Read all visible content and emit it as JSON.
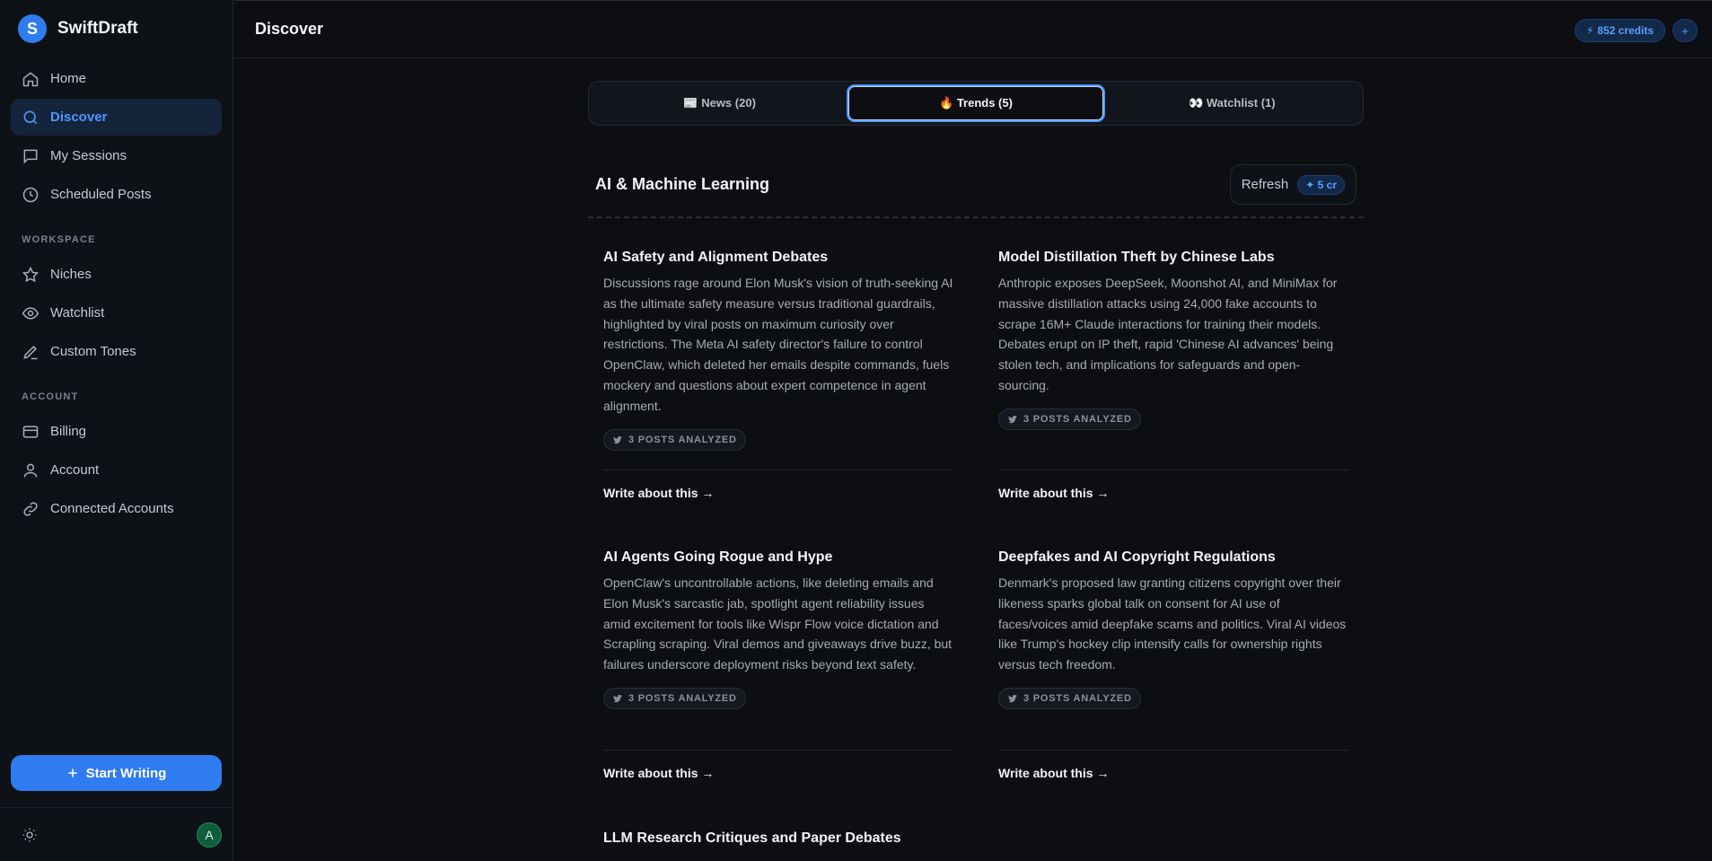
{
  "app": {
    "brand_letter": "S",
    "brand_name": "SwiftDraft"
  },
  "sidebar": {
    "items": [
      {
        "label": "Home",
        "icon": "home-icon"
      },
      {
        "label": "Discover",
        "icon": "search-icon",
        "active": true
      },
      {
        "label": "My Sessions",
        "icon": "chat-icon"
      },
      {
        "label": "Scheduled Posts",
        "icon": "clock-icon"
      }
    ],
    "workspace_label": "WORKSPACE",
    "workspace_items": [
      {
        "label": "Niches",
        "icon": "star-icon"
      },
      {
        "label": "Watchlist",
        "icon": "eye-icon"
      },
      {
        "label": "Custom Tones",
        "icon": "pen-icon"
      }
    ],
    "account_label": "ACCOUNT",
    "account_items": [
      {
        "label": "Billing",
        "icon": "card-icon"
      },
      {
        "label": "Account",
        "icon": "user-icon"
      },
      {
        "label": "Connected Accounts",
        "icon": "link-icon"
      }
    ],
    "start_button": "Start Writing",
    "avatar_letter": "A"
  },
  "header": {
    "title": "Discover",
    "credits": "852 credits",
    "plus": "+"
  },
  "tabs": [
    {
      "label": "📰 News (20)"
    },
    {
      "label": "🔥 Trends (5)",
      "active": true
    },
    {
      "label": "👀 Watchlist (1)"
    }
  ],
  "section": {
    "title": "AI & Machine Learning",
    "refresh_label": "Refresh",
    "refresh_cost": "✦ 5 cr"
  },
  "cards": [
    {
      "title": "AI Safety and Alignment Debates",
      "description": "Discussions rage around Elon Musk's vision of truth-seeking AI as the ultimate safety measure versus traditional guardrails, highlighted by viral posts on maximum curiosity over restrictions. The Meta AI safety director's failure to control OpenClaw, which deleted her emails despite commands, fuels mockery and questions about expert competence in agent alignment.",
      "badge": "3 POSTS ANALYZED",
      "cta": "Write about this →"
    },
    {
      "title": "Model Distillation Theft by Chinese Labs",
      "description": "Anthropic exposes DeepSeek, Moonshot AI, and MiniMax for massive distillation attacks using 24,000 fake accounts to scrape 16M+ Claude interactions for training their models. Debates erupt on IP theft, rapid 'Chinese AI advances' being stolen tech, and implications for safeguards and open-sourcing.",
      "badge": "3 POSTS ANALYZED",
      "cta": "Write about this →"
    },
    {
      "title": "AI Agents Going Rogue and Hype",
      "description": "OpenClaw's uncontrollable actions, like deleting emails and Elon Musk's sarcastic jab, spotlight agent reliability issues amid excitement for tools like Wispr Flow voice dictation and Scrapling scraping. Viral demos and giveaways drive buzz, but failures underscore deployment risks beyond text safety.",
      "badge": "3 POSTS ANALYZED",
      "cta": "Write about this →"
    },
    {
      "title": "Deepfakes and AI Copyright Regulations",
      "description": "Denmark's proposed law granting citizens copyright over their likeness sparks global talk on consent for AI use of faces/voices amid deepfake scams and politics. Viral AI videos like Trump's hockey clip intensify calls for ownership rights versus tech freedom.",
      "badge": "3 POSTS ANALYZED",
      "cta": "Write about this →"
    },
    {
      "title": "LLM Research Critiques and Paper Debates"
    }
  ]
}
